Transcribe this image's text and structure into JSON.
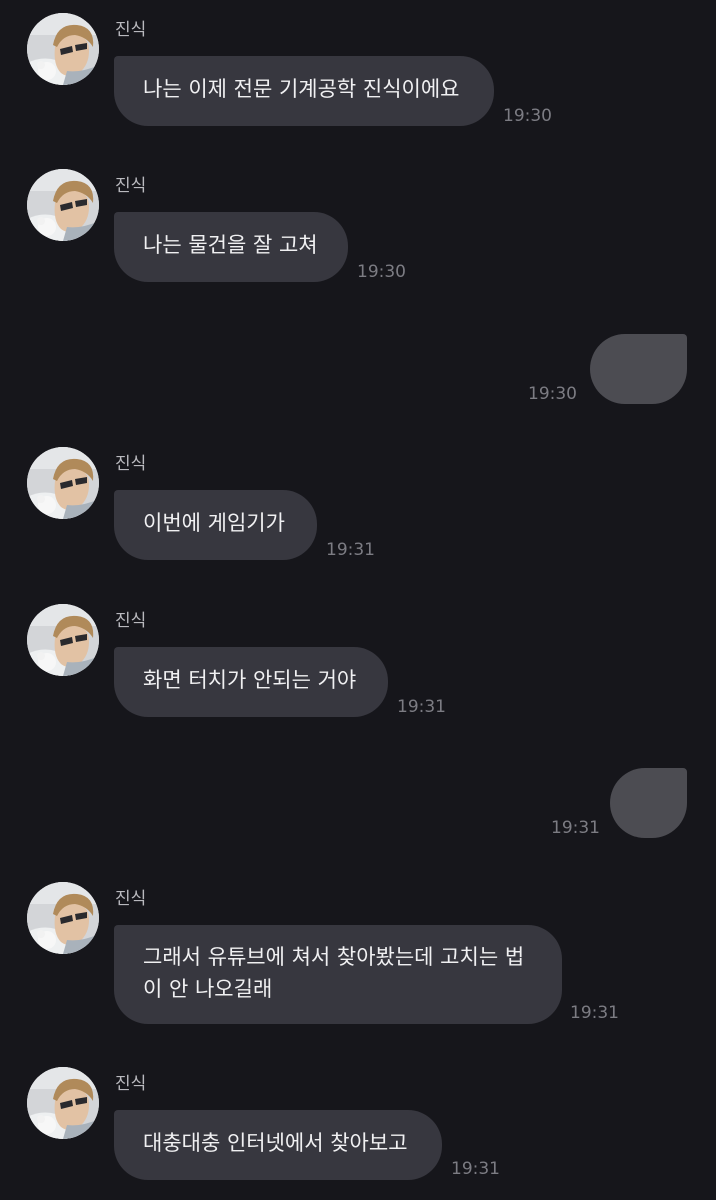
{
  "messages": [
    {
      "type": "received",
      "sender": "진식",
      "text": "나는 이제 전문 기계공학 진식이에요",
      "time": "19:30"
    },
    {
      "type": "received",
      "sender": "진식",
      "text": "나는 물건을 잘 고쳐",
      "time": "19:30"
    },
    {
      "type": "sent",
      "text": "",
      "time": "19:30"
    },
    {
      "type": "received",
      "sender": "진식",
      "text": "이번에 게임기가",
      "time": "19:31"
    },
    {
      "type": "received",
      "sender": "진식",
      "text": "화면 터치가 안되는 거야",
      "time": "19:31"
    },
    {
      "type": "sent",
      "text": "",
      "time": "19:31"
    },
    {
      "type": "received",
      "sender": "진식",
      "text": "그래서 유튜브에 쳐서 찾아봤는데 고치는 법이 안 나오길래",
      "time": "19:31"
    },
    {
      "type": "received",
      "sender": "진식",
      "text": "대충대충 인터넷에서 찾아보고",
      "time": "19:31"
    }
  ],
  "colors": {
    "background": "#16161b",
    "received_bubble": "#37373f",
    "sent_bubble": "#4c4c52",
    "message_text": "#f0f0f2",
    "time_text": "#7c7c83",
    "name_text": "#b9b9be"
  }
}
